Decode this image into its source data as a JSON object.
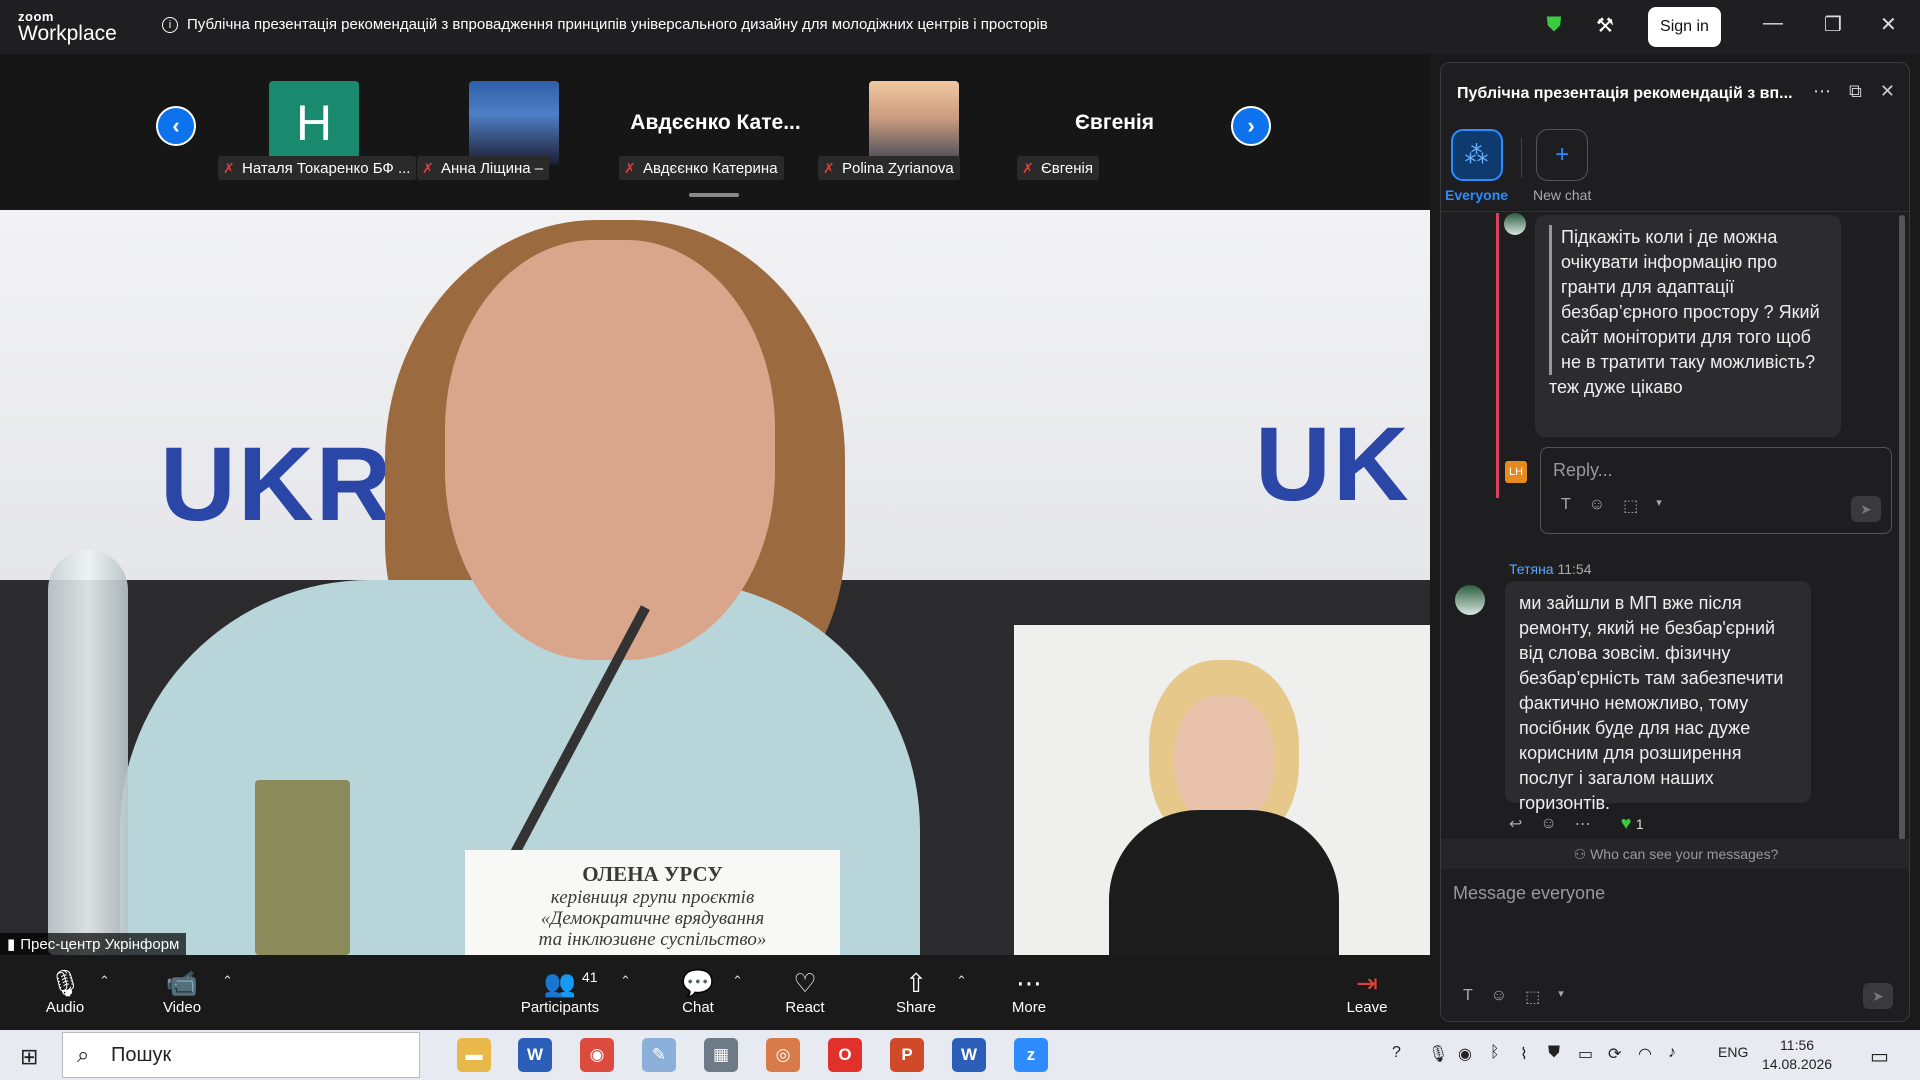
{
  "app": {
    "brand_top": "zoom",
    "brand_bottom": "Workplace",
    "meeting_title": "Публічна презентація рекомендацій з впровадження принципів універсального дизайну для молодіжних центрів і просторів",
    "info_icon": "ⓘ",
    "signin_label": "Sign in"
  },
  "participants_strip": [
    {
      "initial": "H",
      "name": "Наталя Токаренко БФ ..."
    },
    {
      "name": "Анна Ліщина –"
    },
    {
      "display": "Авдєєнко Кате...",
      "name": "Авдєєнко Катерина"
    },
    {
      "name": "Polina Zyrianova"
    },
    {
      "display": "Євгенія",
      "name": "Євгенія"
    }
  ],
  "video": {
    "logo_left": "UKR",
    "logo_right": "UK",
    "nameplate_name": "ОЛЕНА УРСУ",
    "nameplate_line1": "керівниця групи проєктів",
    "nameplate_line2": "«Демократичне врядування",
    "nameplate_line3": "та інклюзивне суспільство»",
    "source_label": "Прес-центр Укрінформ"
  },
  "toolbar": {
    "audio": "Audio",
    "video": "Video",
    "participants": "Participants",
    "participants_count": "41",
    "chat": "Chat",
    "react": "React",
    "share": "Share",
    "more": "More",
    "leave": "Leave"
  },
  "chat": {
    "title": "Публічна презентація рекомендацій з вп...",
    "everyone_label": "Everyone",
    "new_chat_label": "New chat",
    "quoted_text": "Підкажіть коли і де можна очікувати інформацію про гранти для адаптації безбар’єрного простору ? Який сайт моніторити для того щоб не в тратити таку можливість?",
    "reply_text": "теж дуже цікаво",
    "reply_initials": "LH",
    "reply_placeholder": "Reply...",
    "sender_name": "Тетяна",
    "sender_time": "11:54",
    "message": "ми зайшли в МП вже після ремонту, який не безбар'єрний від слова зовсім. фізичну безбар'єрність там забезпечити фактично неможливо, тому посібник буде для нас дуже корисним для розширення послуг і загалом наших горизонтів.",
    "heart_count": "1",
    "who_can_see": "Who can see your messages?",
    "message_placeholder": "Message everyone"
  },
  "taskbar": {
    "search_placeholder": "Пошук",
    "lang": "ENG",
    "time": "11:56",
    "date": "14.08.2026"
  },
  "colors": {
    "accent": "#0e72ed",
    "chat_link": "#5aa8ff",
    "thread_bar": "#d94060",
    "reaction_heart": "#3acc40"
  }
}
